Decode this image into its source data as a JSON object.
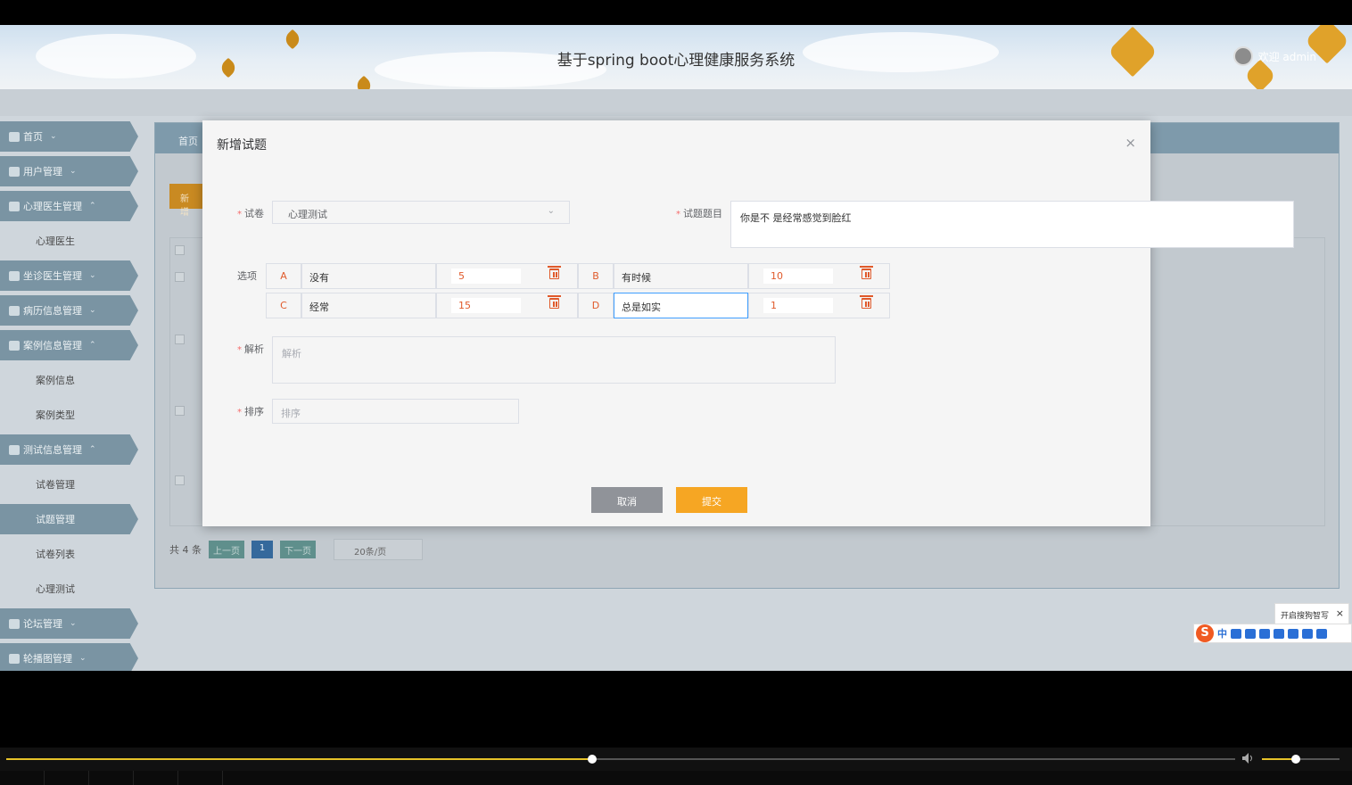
{
  "header": {
    "title": "基于spring boot心理健康服务系统",
    "welcome": "欢迎 admin"
  },
  "sidebar": {
    "items": [
      {
        "label": "首页",
        "type": "menu"
      },
      {
        "label": "用户管理",
        "type": "menu"
      },
      {
        "label": "心理医生管理",
        "type": "menu"
      },
      {
        "label": "心理医生",
        "type": "sub"
      },
      {
        "label": "坐诊医生管理",
        "type": "menu"
      },
      {
        "label": "病历信息管理",
        "type": "menu"
      },
      {
        "label": "案例信息管理",
        "type": "menu"
      },
      {
        "label": "案例信息",
        "type": "sub"
      },
      {
        "label": "案例类型",
        "type": "sub"
      },
      {
        "label": "测试信息管理",
        "type": "menu"
      },
      {
        "label": "试卷管理",
        "type": "sub"
      },
      {
        "label": "试题管理",
        "type": "sub"
      },
      {
        "label": "试卷列表",
        "type": "sub"
      },
      {
        "label": "心理测试",
        "type": "sub"
      },
      {
        "label": "论坛管理",
        "type": "menu"
      },
      {
        "label": "轮播图管理",
        "type": "menu"
      }
    ]
  },
  "page": {
    "breadcrumb": "首页",
    "new_button": "新增",
    "pager": {
      "total": "共 4 条",
      "prev": "上一页",
      "current": "1",
      "next": "下一页",
      "page_size": "20条/页"
    }
  },
  "modal": {
    "title": "新增试题",
    "close": "×",
    "paper_label": "试卷",
    "paper_value": "心理测试",
    "question_label": "试题题目",
    "question_value": "你是不 是经常感觉到脸红",
    "options_label": "选项",
    "options": [
      {
        "letter": "A",
        "text": "没有",
        "score": "5"
      },
      {
        "letter": "B",
        "text": "有时候",
        "score": "10"
      },
      {
        "letter": "C",
        "text": "经常",
        "score": "15"
      },
      {
        "letter": "D",
        "text": "总是如实",
        "score": "1"
      }
    ],
    "analysis_label": "解析",
    "analysis_placeholder": "解析",
    "sort_label": "排序",
    "sort_placeholder": "排序",
    "cancel": "取消",
    "submit": "提交"
  },
  "ime": {
    "tip": "开启搜狗智写",
    "logo": "S",
    "mode": "中"
  },
  "player": {
    "progress": 0.477,
    "volume": 0.44
  },
  "colors": {
    "accent": "#f6a623",
    "menu": "#7a94a3",
    "option_letter": "#e05a2b"
  }
}
